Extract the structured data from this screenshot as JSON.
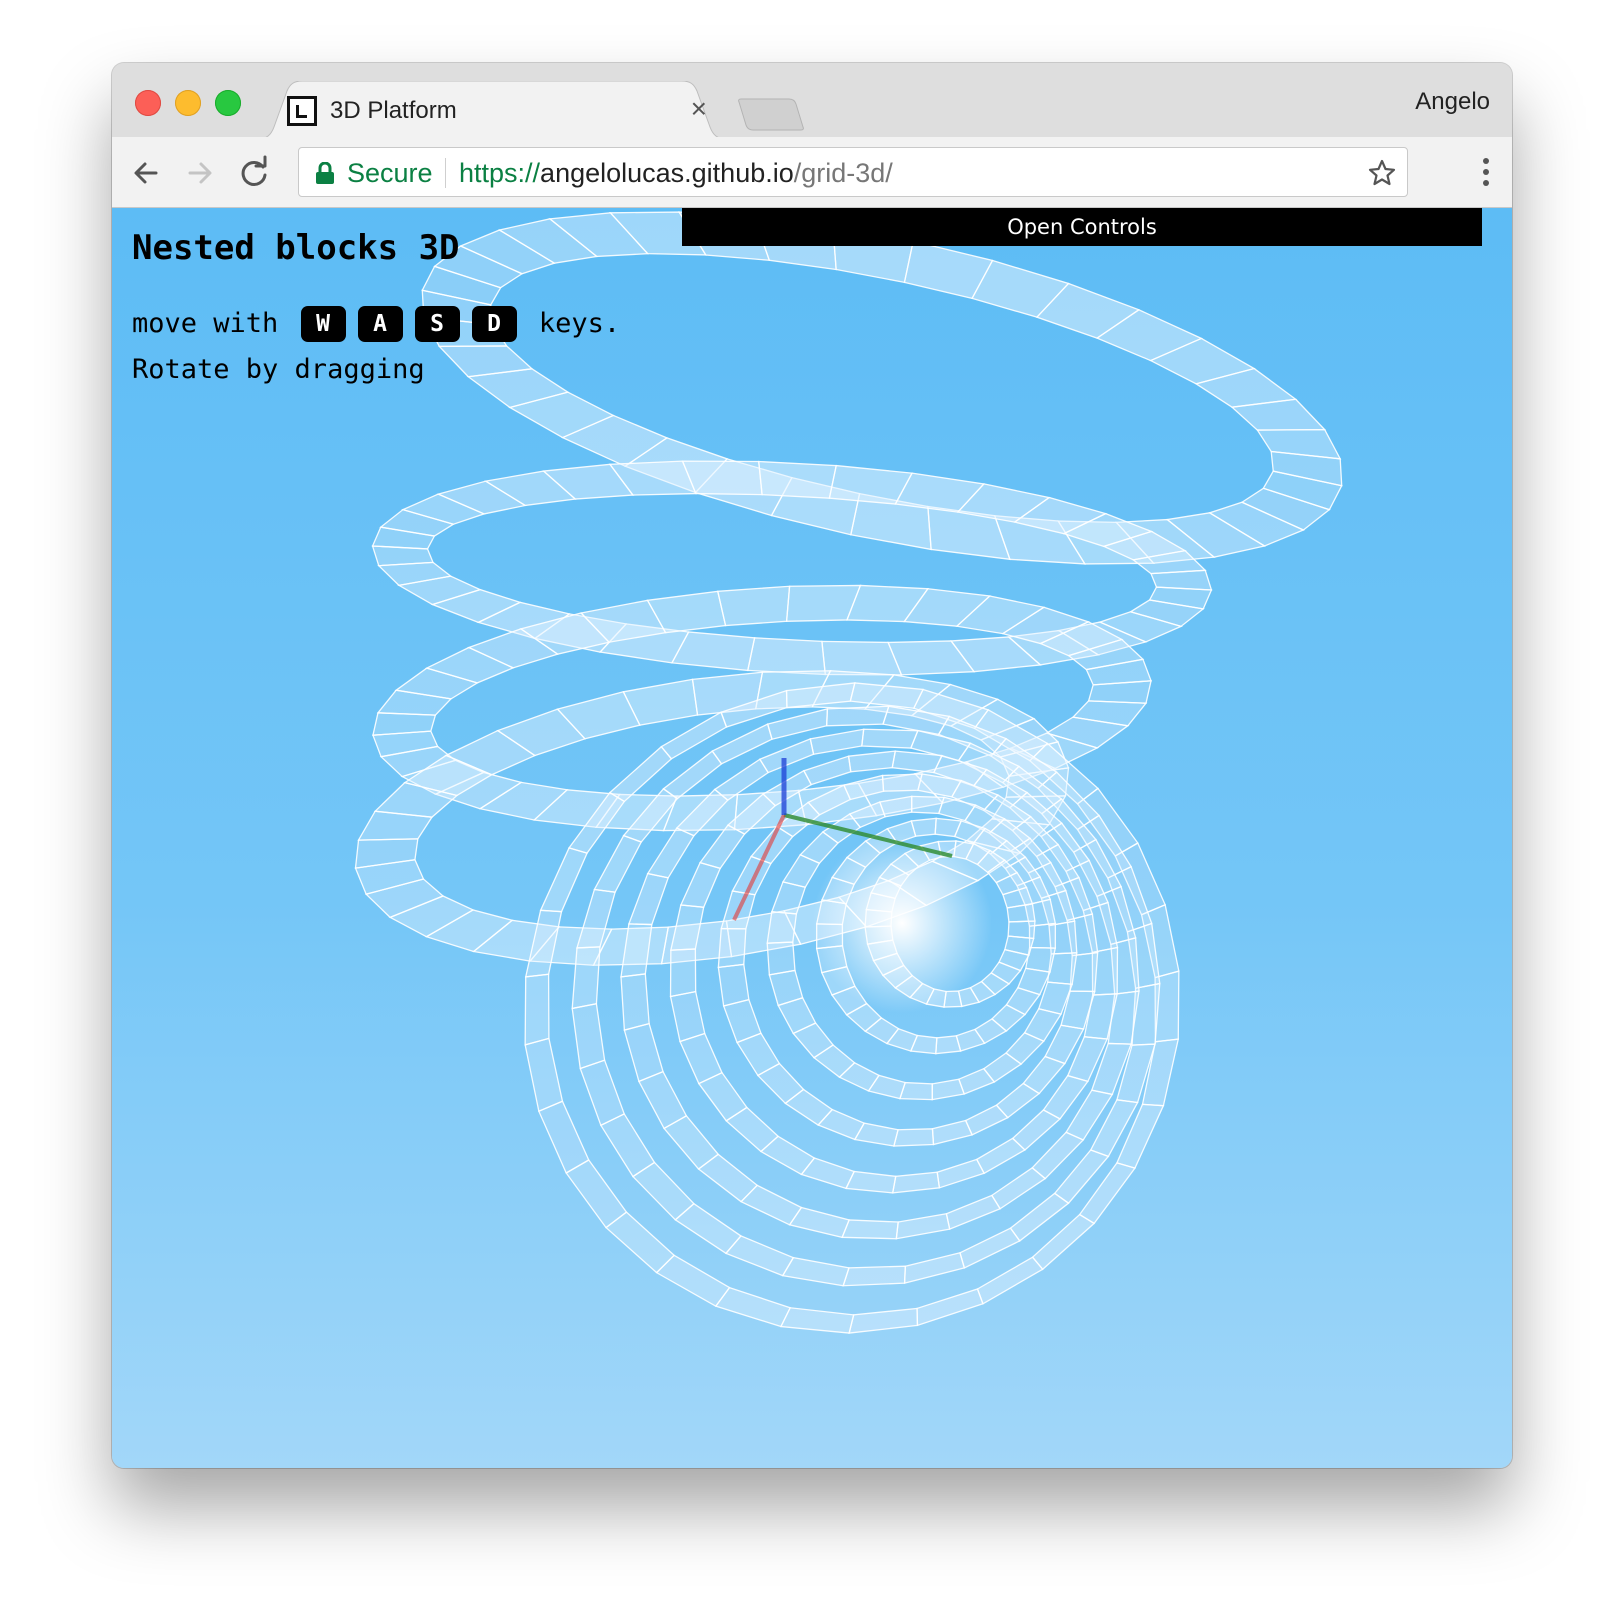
{
  "window": {
    "tab_title": "3D Platform",
    "tab_close": "×",
    "profile_name": "Angelo"
  },
  "toolbar": {
    "secure_label": "Secure",
    "url_scheme": "https://",
    "url_host": "angelolucas.github.io",
    "url_path": "/grid-3d/"
  },
  "page": {
    "controls_button": "Open Controls",
    "heading": "Nested blocks 3D",
    "instruction_prefix": "move with",
    "keys": [
      "W",
      "A",
      "S",
      "D"
    ],
    "instruction_suffix": "keys.",
    "rotate_hint": "Rotate by dragging"
  },
  "colors": {
    "secure_green": "#0b8043",
    "sky_top": "#5dbcf5",
    "sky_bottom": "#a2d7f9",
    "axis_x": "#e53935",
    "axis_y": "#2e8b2e",
    "axis_z": "#1e3fd6"
  },
  "icons": [
    "back-arrow-icon",
    "forward-arrow-icon",
    "reload-icon",
    "lock-icon",
    "star-icon",
    "menu-dots-icon",
    "favicon-icon",
    "close-icon"
  ]
}
